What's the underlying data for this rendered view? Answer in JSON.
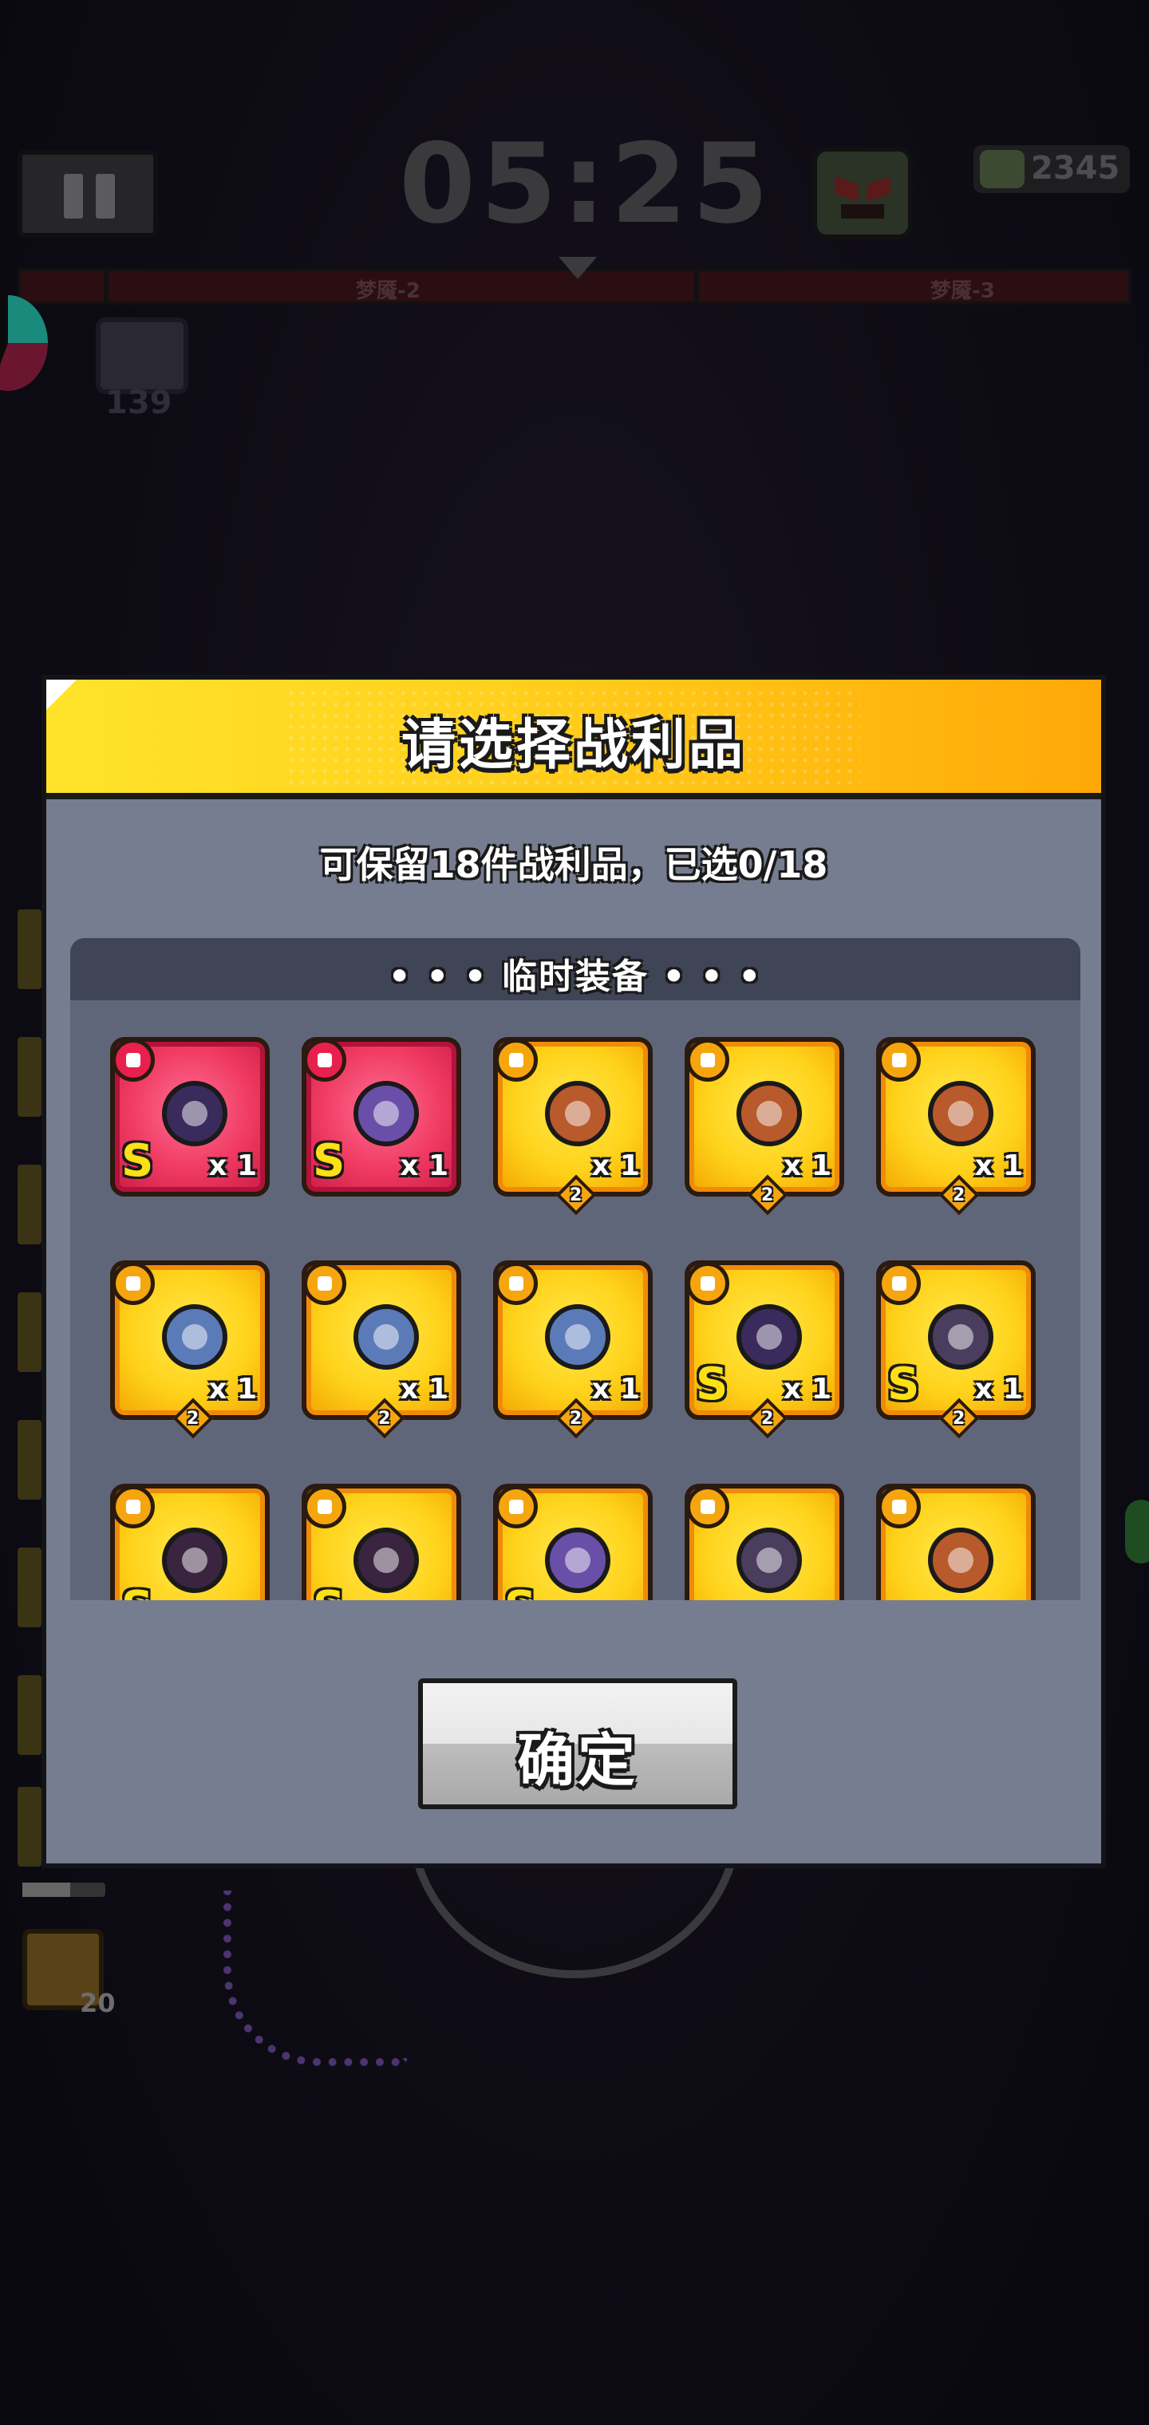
{
  "hud": {
    "timer": "05:25",
    "kill_count": "2345",
    "stage_labels": [
      "梦魇-2",
      "梦魇-3"
    ],
    "chest_count": "139",
    "heart_count": "20"
  },
  "modal": {
    "title": "请选择战利品",
    "subtitle": "可保留18件战利品，已选0/18",
    "section_title": "• • • 临时装备 • • •",
    "confirm_label": "确定"
  },
  "items": [
    {
      "name": "weapon-dark-star",
      "slot": "weapon",
      "rarity": "red",
      "grade": "S",
      "qty": "x 1",
      "level": ""
    },
    {
      "name": "boots-purple",
      "slot": "boots",
      "rarity": "red",
      "grade": "S",
      "qty": "x 1",
      "level": ""
    },
    {
      "name": "necklace-fang",
      "slot": "necklace",
      "rarity": "gold",
      "grade": "",
      "qty": "x 1",
      "level": "2"
    },
    {
      "name": "necklace-spiked-collar",
      "slot": "necklace",
      "rarity": "gold",
      "grade": "",
      "qty": "x 1",
      "level": "2"
    },
    {
      "name": "necklace-spiked-collar-2",
      "slot": "necklace",
      "rarity": "gold",
      "grade": "",
      "qty": "x 1",
      "level": "2"
    },
    {
      "name": "gloves-fur",
      "slot": "gloves",
      "rarity": "gold",
      "grade": "",
      "qty": "x 1",
      "level": "2"
    },
    {
      "name": "gloves-steel",
      "slot": "gloves",
      "rarity": "gold",
      "grade": "",
      "qty": "x 1",
      "level": "2"
    },
    {
      "name": "gloves-crystal",
      "slot": "gloves",
      "rarity": "gold",
      "grade": "",
      "qty": "x 1",
      "level": "2"
    },
    {
      "name": "weapon-blaster",
      "slot": "weapon",
      "rarity": "gold",
      "grade": "S",
      "qty": "x 1",
      "level": "2"
    },
    {
      "name": "armor-dark",
      "slot": "armor",
      "rarity": "gold",
      "grade": "S",
      "qty": "x 1",
      "level": "2"
    },
    {
      "name": "belt-dark-1",
      "slot": "belt",
      "rarity": "gold",
      "grade": "S",
      "qty": "",
      "level": ""
    },
    {
      "name": "belt-dark-2",
      "slot": "belt",
      "rarity": "gold",
      "grade": "S",
      "qty": "",
      "level": ""
    },
    {
      "name": "boots-dark",
      "slot": "boots",
      "rarity": "gold",
      "grade": "S",
      "qty": "",
      "level": ""
    },
    {
      "name": "armor-steel",
      "slot": "armor",
      "rarity": "gold",
      "grade": "",
      "qty": "",
      "level": ""
    },
    {
      "name": "necklace-fang-2",
      "slot": "necklace",
      "rarity": "gold",
      "grade": "",
      "qty": "",
      "level": ""
    }
  ],
  "colors": {
    "modal_bg": "#777d90",
    "header_yellow": "#ffd21e",
    "item_gold": "#ffd21a",
    "item_red": "#f03a62"
  }
}
